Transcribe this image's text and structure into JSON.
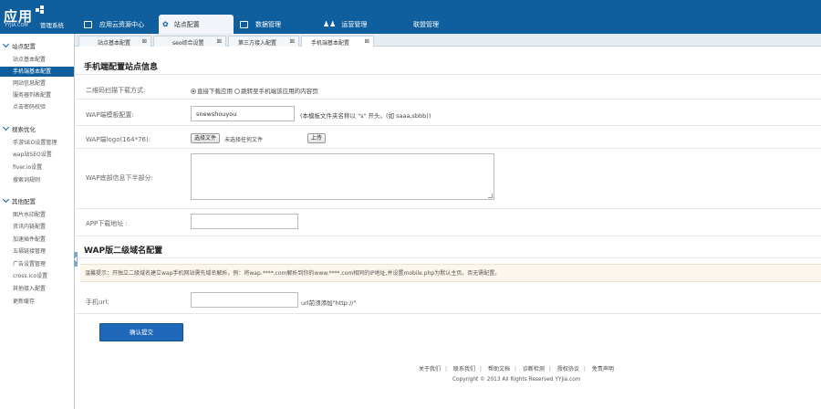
{
  "brand": {
    "logo_cn": "应用",
    "logo_en": "YYJIA.COM",
    "system": "管理系统"
  },
  "topnav": [
    {
      "label": "应用云资源中心",
      "active": false
    },
    {
      "label": "站点配置",
      "active": true
    },
    {
      "label": "数据管理",
      "active": false
    },
    {
      "label": "运营管理",
      "active": false
    },
    {
      "label": "联盟管理",
      "active": false
    }
  ],
  "tabs": [
    {
      "label": "站点基本配置",
      "active": false
    },
    {
      "label": "seo综合设置",
      "active": false
    },
    {
      "label": "第三方接入配置",
      "active": false
    },
    {
      "label": "手机端基本配置",
      "active": true
    }
  ],
  "sidebar": {
    "groups": [
      {
        "title": "站点配置",
        "items": [
          "站点基本配置",
          "手机端基本配置",
          "网站信息配置",
          "服务器列表配置",
          "点击密码校验"
        ]
      },
      {
        "title": "搜索优化",
        "items": [
          "手游SEO设置管理",
          "wap站SEO设置",
          "fiver.io设置",
          "搜索词规则"
        ]
      },
      {
        "title": "其他配置",
        "items": [
          "图片水印配置",
          "资讯内链配置",
          "加速插件配置",
          "五福链接管理",
          "广告设置管理",
          "cross.ico设置",
          "其他接入配置",
          "更新缓存"
        ]
      }
    ],
    "active_item": "手机端基本配置"
  },
  "main": {
    "section1_title": "手机端配置站点信息",
    "qr_label": "二维码扫描下载方式:",
    "qr_option1": "直接下载应用",
    "qr_option2": "跳转至手机端该应用的内容页",
    "wap_template_label": "WAP端模板配置:",
    "wap_template_value": "snewshouyou",
    "wap_template_hint": "(本模板文件夹名称以 \"s\" 开头。(如 saaa,sbbb))",
    "wap_logo_label": "WAP端logo(164*76):",
    "choose_file_label": "选择文件",
    "no_file_label": "未选择任何文件",
    "upload_label": "上传",
    "footer_info_label": "WAP底部信息下半部分:",
    "app_download_label": "APP下载地址 :",
    "app_download_value": "",
    "section2_title": "WAP版二级域名配置",
    "notice": "温馨提示：开独立二级域名建立wap手机网站需先域名解析，例：将wap.****.com解析到你的www.****.com相同的IP地址,并设置mobile.php为默认主页。否无需配置。",
    "mobile_url_label": "手机url:",
    "mobile_url_value": "",
    "mobile_url_hint": "url前须添加\"http://\"",
    "submit_label": "确认提交"
  },
  "footer": {
    "links": [
      "关于我们",
      "联系我们",
      "帮助文档",
      "诊断检测",
      "授权协议",
      "免责声明"
    ],
    "copyright": "Copyright © 2013 All Rights Reserved YYjia.com"
  }
}
